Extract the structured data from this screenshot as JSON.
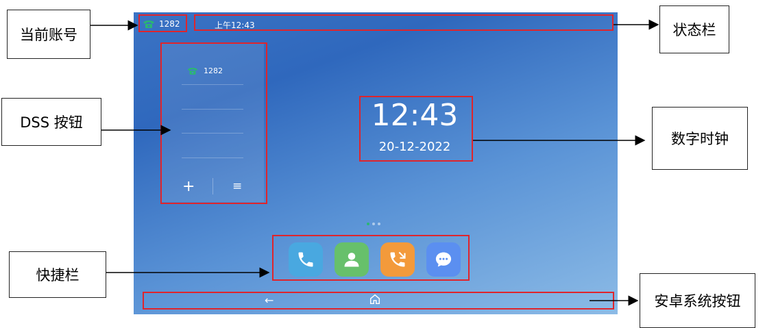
{
  "status_bar": {
    "account": "1282",
    "time": "上午12:43"
  },
  "dss": {
    "account": "1282",
    "add_symbol": "+",
    "menu_symbol": "≡"
  },
  "clock": {
    "time": "12:43",
    "date": "20-12-2022"
  },
  "dock": {
    "apps": [
      "phone-icon",
      "contacts-icon",
      "call-history-icon",
      "messages-icon"
    ]
  },
  "nav": {
    "back_symbol": "←",
    "home_symbol": "⌂"
  },
  "callouts": {
    "current_account": "当前账号",
    "status_bar": "状态栏",
    "dss_buttons": "DSS  按钮",
    "digital_clock": "数字时钟",
    "shortcut_bar": "快捷栏",
    "android_buttons": "安卓系统按钮"
  },
  "colors": {
    "accent_green": "#2bb673",
    "highlight_red": "#e0242b",
    "phone_blue": "#49a8e0",
    "contacts_green": "#67c06b",
    "history_orange": "#f39a3b",
    "messages_blue": "#5b8ff0"
  }
}
